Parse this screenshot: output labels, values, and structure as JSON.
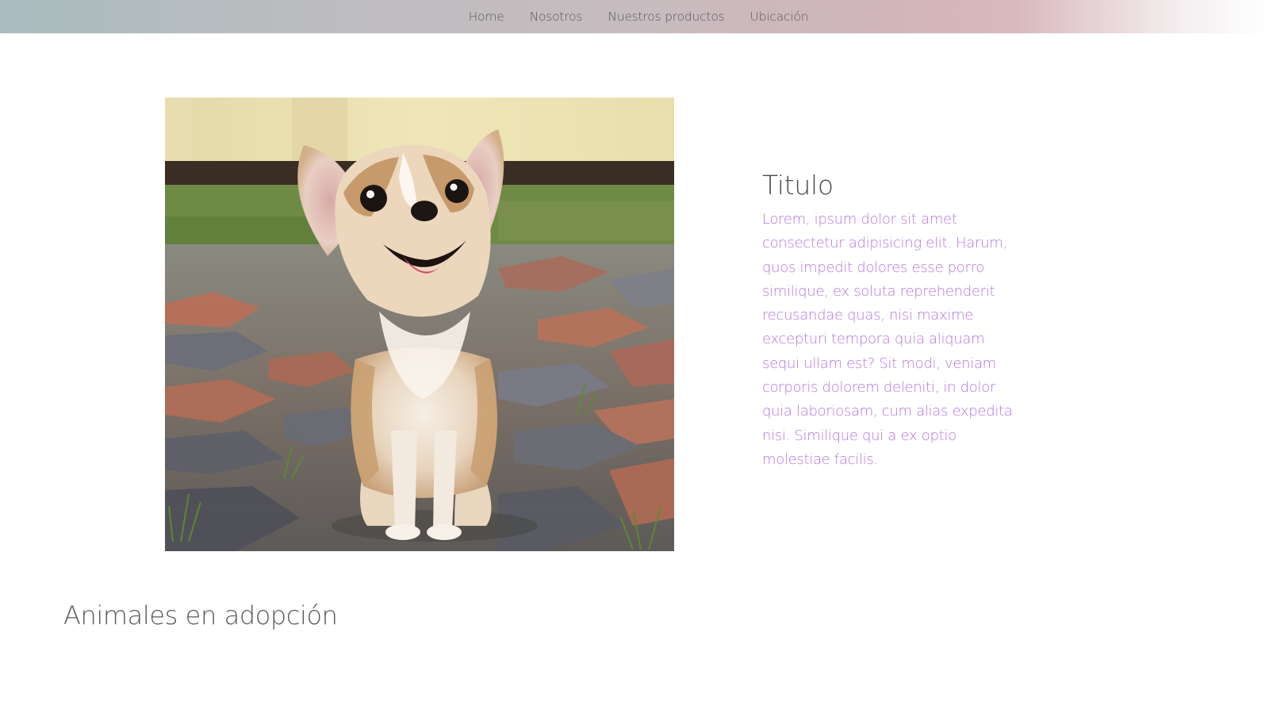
{
  "nav": {
    "items": [
      {
        "label": "Home"
      },
      {
        "label": "Nosotros"
      },
      {
        "label": "Nuestros productos"
      },
      {
        "label": "Ubicación"
      }
    ]
  },
  "hero": {
    "image_icon": "chihuahua-puppy-photo",
    "title": "Titulo",
    "body": "Lorem, ipsum dolor sit amet consectetur adipisicing elit. Harum, quos impedit dolores esse porro similique, ex soluta reprehenderit recusandae quas, nisi maxime excepturi tempora quia aliquam sequi ullam est? Sit modi, veniam corporis dolorem deleniti, in dolor quia laboriosam, cum alias expedita nisi. Similique qui a ex optio molestiae facilis."
  },
  "adoption": {
    "heading": "Animales en adopción"
  },
  "colors": {
    "body_text": "#b276e6",
    "title": "#4a4a4a",
    "nav_text": "#555a5c"
  }
}
